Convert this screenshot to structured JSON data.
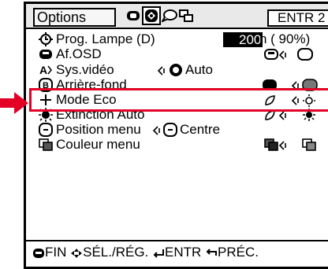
{
  "header": {
    "tab_label": "Options",
    "tab_icons": [
      "display-icon",
      "options-icon",
      "speech-bubble-icon",
      "network-icon"
    ],
    "selected_tab_icon": "options-icon",
    "entr_label": "ENTR 2"
  },
  "menu": {
    "rows": [
      {
        "icon": "lamp-timer-icon",
        "label": "Prog. Lampe (D)",
        "value": "200",
        "value_suffix": "h ( 90%)"
      },
      {
        "icon": "osd-icon",
        "label": "Af.OSD"
      },
      {
        "icon": "video-system-icon",
        "label": "Sys.vidéo",
        "value": "Auto"
      },
      {
        "icon": "background-icon",
        "label": "Arrière-fond"
      },
      {
        "icon": "eco-mode-icon",
        "label": "Mode Eco"
      },
      {
        "icon": "auto-off-icon",
        "label": "Extinction Auto"
      },
      {
        "icon": "menu-position-icon",
        "label": "Position menu",
        "value": "Centre"
      },
      {
        "icon": "menu-color-icon",
        "label": "Couleur menu"
      }
    ],
    "selected_index": 3
  },
  "footer": {
    "items": [
      "FIN",
      "SÉL./RÉG.",
      "ENTR",
      "PRÉC."
    ]
  },
  "colors": {
    "highlight": "#e20025",
    "tab_bg": "#e9e9e9"
  }
}
